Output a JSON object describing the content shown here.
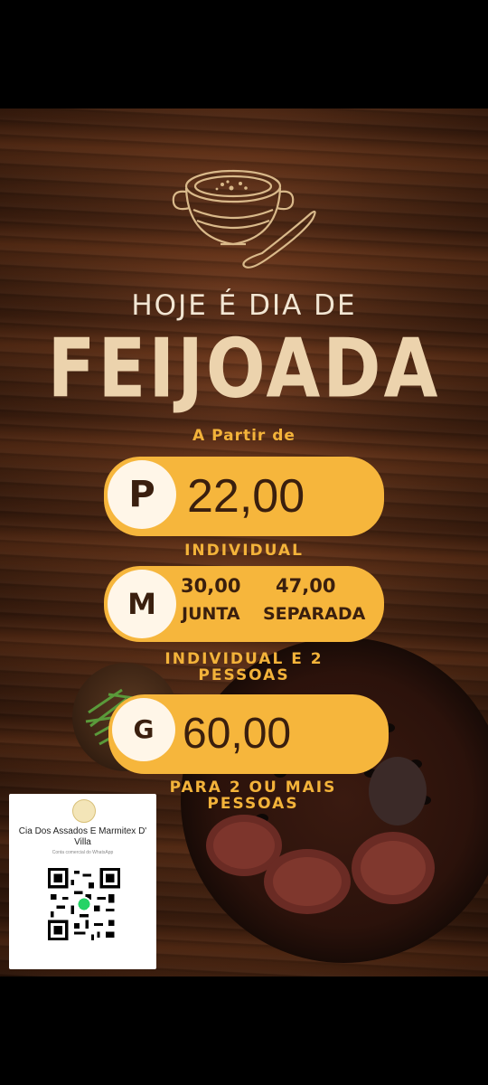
{
  "poster": {
    "headline": "HOJE É DIA DE",
    "title": "FEIJOADA",
    "from_label": "A Partir de",
    "sizes": [
      {
        "letter": "P",
        "price": "22,00",
        "caption": "INDIVIDUAL"
      },
      {
        "letter": "M",
        "price_together": "30,00",
        "label_together": "JUNTA",
        "price_separate": "47,00",
        "label_separate": "SEPARADA",
        "caption": "INDIVIDUAL E 2 PESSOAS"
      },
      {
        "letter": "G",
        "price": "60,00",
        "caption": "PARA 2 OU MAIS PESSOAS"
      }
    ]
  },
  "qr_card": {
    "business_name": "Cia Dos Assados E Marmitex D' Villa",
    "note": "Conta comercial do WhatsApp"
  },
  "colors": {
    "accent": "#f6b63c",
    "title_cream": "#ecd3ad",
    "text_dark": "#3a1f0e"
  },
  "icons": {
    "pot": "soup-pot-icon",
    "whatsapp": "whatsapp-icon"
  }
}
